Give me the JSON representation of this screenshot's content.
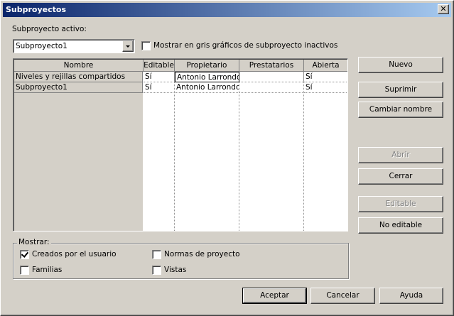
{
  "window": {
    "title": "Subproyectos"
  },
  "active_subproject": {
    "label": "Subproyecto activo:",
    "value": "Subproyecto1"
  },
  "gray_inactive": {
    "label": "Mostrar en gris gráficos de subproyecto inactivos",
    "checked": false
  },
  "table": {
    "columns": [
      "Nombre",
      "Editable",
      "Propietario",
      "Prestatarios",
      "Abierta"
    ],
    "rows": [
      {
        "name": "Niveles y rejillas compartidos",
        "editable": "Sí",
        "owner": "Antonio Larrondo",
        "borrowers": "",
        "open": "Sí"
      },
      {
        "name": "Subproyecto1",
        "editable": "Sí",
        "owner": "Antonio Larrondo",
        "borrowers": "",
        "open": "Sí"
      }
    ]
  },
  "side_buttons": {
    "new": "Nuevo",
    "delete": "Suprimir",
    "rename": "Cambiar nombre",
    "open": "Abrir",
    "close": "Cerrar",
    "editable": "Editable",
    "not_editable": "No editable"
  },
  "show": {
    "title": "Mostrar:",
    "user_created": {
      "label": "Creados por el usuario",
      "checked": true
    },
    "project_standards": {
      "label": "Normas de proyecto",
      "checked": false
    },
    "families": {
      "label": "Familias",
      "checked": false
    },
    "views": {
      "label": "Vistas",
      "checked": false
    }
  },
  "footer": {
    "accept": "Aceptar",
    "cancel": "Cancelar",
    "help": "Ayuda"
  },
  "colors": {
    "titlebar_start": "#0a246a",
    "titlebar_end": "#a6caf0",
    "dialog_bg": "#d4d0c8"
  }
}
